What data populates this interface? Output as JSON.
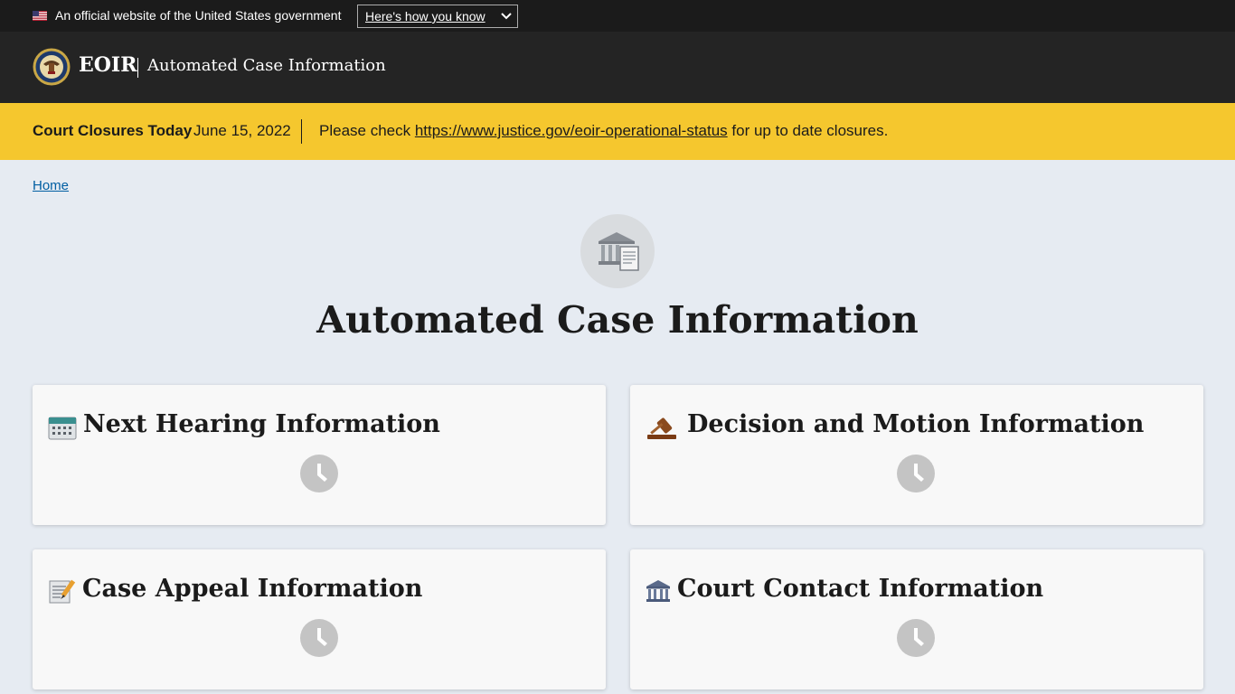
{
  "gov_banner": {
    "text": "An official website of the United States government",
    "how_you_know_label": "Here's how you know",
    "flag_icon": "us-flag-icon",
    "chevron_icon": "chevron-down-icon"
  },
  "header": {
    "agency": "EOIR",
    "site_title": "Automated Case Information",
    "seal_icon": "doj-seal-icon"
  },
  "alert": {
    "title": "Court Closures Today",
    "date": "June 15, 2022",
    "message_prefix": "Please check ",
    "link_text": "https://www.justice.gov/eoir-operational-status",
    "message_suffix": " for up to date closures.",
    "background_color": "#f5c72e"
  },
  "breadcrumb": {
    "home_label": "Home"
  },
  "main": {
    "hero_icon": "courthouse-document-icon",
    "title": "Automated Case Information",
    "cards": [
      {
        "title": "Next Hearing Information",
        "icon": "calendar-icon",
        "status_icon": "clock-icon"
      },
      {
        "title": "Decision and Motion Information",
        "icon": "gavel-icon",
        "status_icon": "clock-icon"
      },
      {
        "title": "Case Appeal Information",
        "icon": "memo-pencil-icon",
        "status_icon": "clock-icon"
      },
      {
        "title": "Court Contact Information",
        "icon": "courthouse-icon",
        "status_icon": "clock-icon"
      }
    ]
  },
  "colors": {
    "banner_bg": "#1b1b1b",
    "header_bg": "#242424",
    "page_bg": "#e6ebf2",
    "link": "#005ea2",
    "card_bg": "#f8f8f8",
    "clock": "#c4c4c4"
  }
}
